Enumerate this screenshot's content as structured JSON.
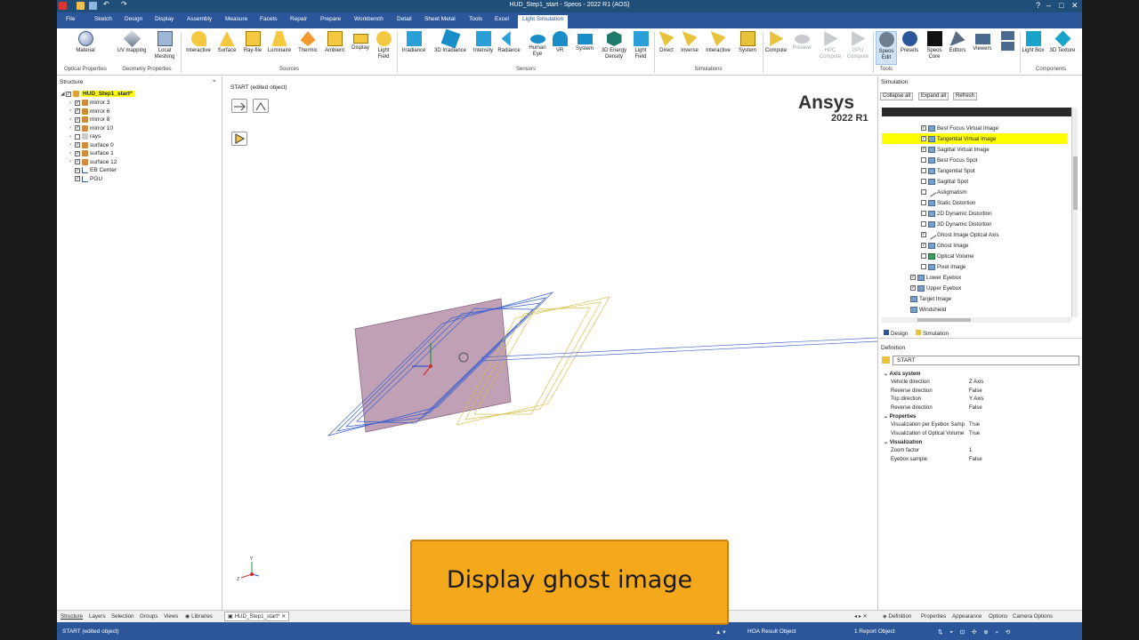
{
  "window": {
    "title": "HUD_Step1_start - Speos - 2022 R1 (AOS)"
  },
  "menu": [
    "File",
    "Sketch",
    "Design",
    "Display",
    "Assembly",
    "Measure",
    "Facets",
    "Repair",
    "Prepare",
    "Workbench",
    "Detail",
    "Sheet Metal",
    "Tools",
    "Excel",
    "Light Simulation"
  ],
  "ribbon": {
    "buttons": [
      "Material",
      "UV mapping",
      "Local Meshing",
      "Interactive",
      "Surface",
      "Ray-file",
      "Luminaire",
      "Thermic",
      "Ambient",
      "Display",
      "Light Field",
      "Irradiance",
      "3D Irradiance",
      "Intensity",
      "Radiance",
      "Human Eye",
      "VR",
      "System",
      "3D Energy Density",
      "Light Field",
      "Direct",
      "Inverse",
      "Interactive",
      "System",
      "Compute",
      "Preview",
      "HPC Compute",
      "GPU Compute",
      "Speos Edit",
      "Presets",
      "Speos Core",
      "Editors",
      "Viewers",
      "Light Box",
      "3D Texture"
    ],
    "groups": [
      "Optical Properties",
      "Geometry Properties",
      "Sources",
      "Sensors",
      "Simulations",
      "Tools",
      "Components"
    ]
  },
  "structure": {
    "title": "Structure",
    "items": [
      {
        "label": "HUD_Step1_start*",
        "checked": true,
        "expanded": true
      },
      {
        "label": "mirror 3",
        "checked": true
      },
      {
        "label": "mirror 6",
        "checked": true
      },
      {
        "label": "mirror 8",
        "checked": true
      },
      {
        "label": "mirror 10",
        "checked": true
      },
      {
        "label": "rays",
        "checked": false
      },
      {
        "label": "surface 0",
        "checked": true
      },
      {
        "label": "surface 1",
        "checked": true
      },
      {
        "label": "surface 12",
        "checked": true
      },
      {
        "label": "EB Center",
        "checked": true
      },
      {
        "label": "PGU",
        "checked": true
      }
    ]
  },
  "viewport": {
    "title": "START (edited object)",
    "brand": "Ansys",
    "version": "2022 R1"
  },
  "simulation": {
    "title": "Simulation",
    "buttons": [
      "Collapse all",
      "Expand all",
      "Refresh"
    ],
    "items": [
      {
        "label": "Best Focus Virtual Image",
        "checked": true,
        "indent": 2
      },
      {
        "label": "Tangential Virtual Image",
        "checked": true,
        "indent": 2,
        "highlight": true
      },
      {
        "label": "Sagittal Virtual Image",
        "checked": true,
        "indent": 2
      },
      {
        "label": "Best Focus Spot",
        "checked": false,
        "indent": 2
      },
      {
        "label": "Tangential Spot",
        "checked": false,
        "indent": 2
      },
      {
        "label": "Sagittal Spot",
        "checked": false,
        "indent": 2
      },
      {
        "label": "Astigmatism",
        "checked": false,
        "indent": 2
      },
      {
        "label": "Static Distortion",
        "checked": false,
        "indent": 2
      },
      {
        "label": "2D Dynamic Distortion",
        "checked": false,
        "indent": 2
      },
      {
        "label": "3D Dynamic Distortion",
        "checked": false,
        "indent": 2
      },
      {
        "label": "Ghost Image Optical Axis",
        "checked": true,
        "indent": 2
      },
      {
        "label": "Ghost Image",
        "checked": true,
        "indent": 2
      },
      {
        "label": "Optical Volume",
        "checked": false,
        "indent": 2
      },
      {
        "label": "Pixel Image",
        "checked": false,
        "indent": 2
      },
      {
        "label": "Lower Eyebox",
        "checked": true,
        "indent": 1
      },
      {
        "label": "Upper Eyebox",
        "checked": true,
        "indent": 1
      },
      {
        "label": "Target Image",
        "checked": null,
        "indent": 1
      },
      {
        "label": "Windshield",
        "checked": null,
        "indent": 1
      }
    ],
    "tabs": [
      "Design",
      "Simulation"
    ]
  },
  "definition": {
    "title": "Definition",
    "name": "START",
    "categories": [
      {
        "label": "Axis system",
        "rows": [
          [
            "Vehicle direction",
            "Z Axis"
          ],
          [
            "Reverse direction",
            "False"
          ],
          [
            "Top direction",
            "Y Axis"
          ],
          [
            "Reverse direction",
            "False"
          ]
        ]
      },
      {
        "label": "Properties",
        "rows": [
          [
            "Visualization per Eyebox Samp",
            "True"
          ],
          [
            "Visualization of Optical Volume",
            "True"
          ]
        ]
      },
      {
        "label": "Visualization",
        "rows": [
          [
            "Zoom factor",
            "1"
          ],
          [
            "Eyebox sample",
            "False"
          ]
        ]
      }
    ]
  },
  "bottom_tabs_left": [
    "Structure",
    "Layers",
    "Selection",
    "Groups",
    "Views",
    "Libraries"
  ],
  "doc_tab": "HUD_Step1_start*",
  "bottom_tabs_right": [
    "Definition",
    "Properties",
    "Appearance",
    "Options",
    "Camera Options"
  ],
  "status": {
    "left": "START (edited object)",
    "center": "HOA Result Object",
    "right": "1 Report Object"
  },
  "caption": "Display ghost image"
}
